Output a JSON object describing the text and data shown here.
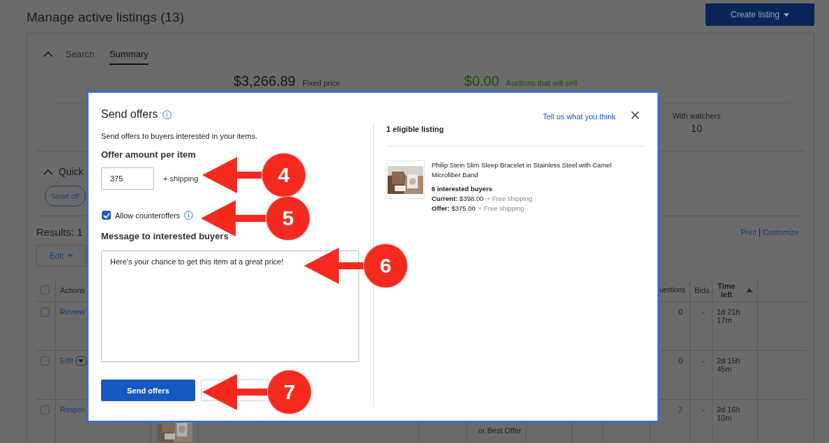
{
  "page": {
    "title": "Manage active listings (13)",
    "create_button": "Create listing"
  },
  "tabs": [
    {
      "label": "Search",
      "selected": false
    },
    {
      "label": "Summary",
      "selected": true
    }
  ],
  "summary": {
    "fixed_price": {
      "amount": "$3,266.89",
      "label": "Fixed price"
    },
    "auctions": {
      "amount": "$0.00",
      "label": "Auctions that will sell"
    },
    "watchers": {
      "label": "With watchers",
      "value": "10"
    }
  },
  "quick_actions": {
    "title": "Quick",
    "button": "Send off"
  },
  "results": {
    "label": "Results: 1",
    "links": [
      "Print",
      "Customize"
    ]
  },
  "edit_button": "Edit",
  "table": {
    "header_checked": false,
    "columns": [
      {
        "label": "Actions"
      },
      {
        "label": "uestions"
      },
      {
        "label": "Bids"
      },
      {
        "label": "Time left",
        "sort_ascending": true
      }
    ],
    "rows": [
      {
        "checked": false,
        "action": "Review",
        "questions": "0",
        "questions_link": false,
        "bids": "-",
        "time_left": "1d 21h 17m"
      },
      {
        "checked": false,
        "action": "Edit",
        "action_menu": true,
        "questions": "0",
        "questions_link": false,
        "bids": "-",
        "time_left": "2d 15h 45m"
      },
      {
        "checked": false,
        "action": "Respon",
        "format": "or Best Offer",
        "questions": "2",
        "questions_link": true,
        "bids": "-",
        "time_left": "2d 16h 10m"
      }
    ]
  },
  "modal": {
    "title": "Send offers",
    "subtitle": "Send offers to buyers interested in your items.",
    "amount_label": "Offer amount per item",
    "amount_value": "375",
    "shipping_note": "+ shipping",
    "counteroffers": {
      "label": "Allow counteroffers",
      "checked": true
    },
    "message_label": "Message to interested buyers",
    "message": "Here's your chance to get this item at a great price!",
    "primary_button": "Send offers",
    "feedback_link": "Tell us what you think",
    "eligible": "1 eligible listing",
    "listing": {
      "title": "Philip Stein Slim Sleep Bracelet in Stainless Steel with Camel Microfiber Band",
      "buyers": "6 interested buyers",
      "prices": [
        {
          "label": "Current:",
          "amount": "$398.00",
          "shipping": "+ Free shipping"
        },
        {
          "label": "Offer:",
          "amount": "$375.00",
          "shipping": "+ Free shipping"
        }
      ]
    }
  },
  "annotations": [
    {
      "number": "4"
    },
    {
      "number": "5"
    },
    {
      "number": "6"
    },
    {
      "number": "7"
    }
  ]
}
